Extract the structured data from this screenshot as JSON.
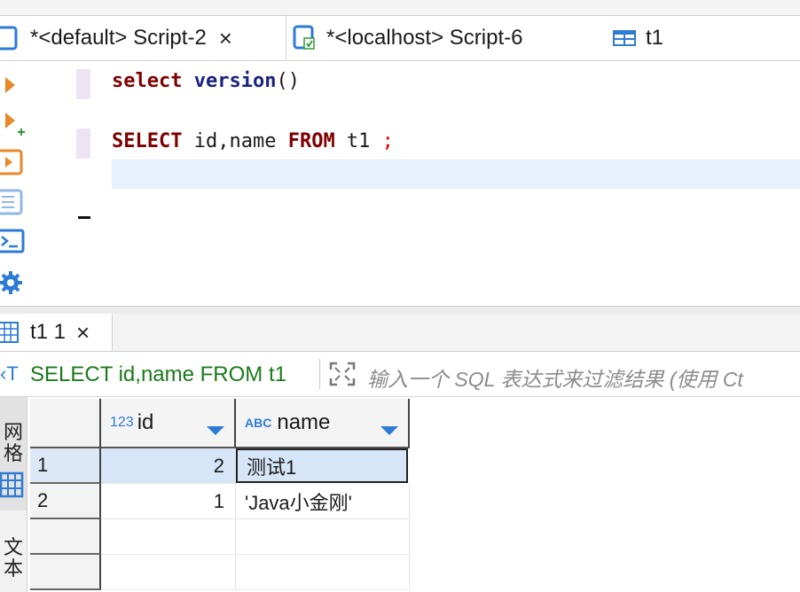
{
  "editor_tabs": [
    {
      "label": "*<default> Script-2",
      "close": "×",
      "active": true
    },
    {
      "label": "*<localhost> Script-6",
      "active": false
    },
    {
      "label": "t1",
      "active": false
    }
  ],
  "editor": {
    "line1": {
      "kw": "select",
      "fn": "version",
      "rest": "()"
    },
    "line2": {
      "kw1": "SELECT",
      "mid": " id,name ",
      "kw2": "FROM",
      "table": " t1 ",
      "semi": ";"
    }
  },
  "results": {
    "tab_label": "t1 1",
    "tab_close": "×",
    "query_label": "SELECT id,name FROM t1",
    "filter_placeholder": "输入一个 SQL 表达式来过滤结果 (使用 Ct",
    "side_tabs": [
      "网格",
      "文本"
    ],
    "columns": [
      {
        "type_badge": "123",
        "name": "id"
      },
      {
        "type_badge": "ABC",
        "name": "name"
      }
    ],
    "rows": [
      {
        "num": "1",
        "id": "2",
        "name": "测试1"
      },
      {
        "num": "2",
        "id": "1",
        "name": "'Java小金刚'"
      }
    ]
  },
  "colors": {
    "keyword": "#7f0000",
    "function": "#1a237e",
    "accent_blue": "#2e7bd6",
    "accent_orange": "#e8882a",
    "query_green": "#1a7a1a",
    "selection": "#d6e6f8"
  },
  "icons": [
    "script-icon",
    "script-connected-icon",
    "table-icon",
    "execute-icon",
    "execute-new-tab-icon",
    "execute-script-icon",
    "explain-icon",
    "console-icon",
    "settings-icon",
    "grid-icon",
    "text-mode-icon",
    "dropdown-arrow-icon",
    "expand-icon"
  ]
}
